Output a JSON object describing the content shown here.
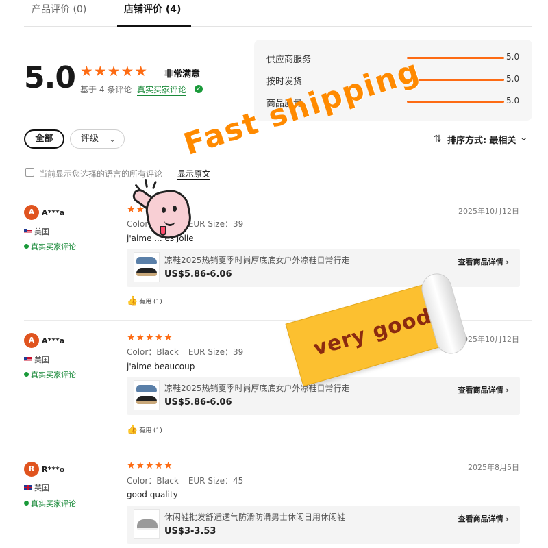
{
  "tabs": [
    {
      "label": "产品评价 (0)"
    },
    {
      "label": "店铺评价 (4)"
    }
  ],
  "summary": {
    "rating": "5.0",
    "stars": "★★★★★",
    "satisfaction": "非常满意",
    "based_on": "基于 4 条评论",
    "verified_link": "真实买家评论",
    "verified_icon": "check-shield-icon"
  },
  "subratings": [
    {
      "label": "供应商服务",
      "value": "5.0",
      "fill": 1.0
    },
    {
      "label": "按时发货",
      "value": "5.0",
      "fill": 1.0
    },
    {
      "label": "商品质量",
      "value": "5.0",
      "fill": 1.0
    }
  ],
  "filters": {
    "all": "全部",
    "grade": "评级",
    "sort_label": "排序方式:",
    "sort_value": "最相关"
  },
  "language_note": {
    "text": "当前显示您选择的语言的所有评论",
    "show_original": "显示原文"
  },
  "reviews": [
    {
      "avatar": "A",
      "user": "A***a",
      "country": "美国",
      "verified": "真实买家评论",
      "stars": "★★★★★",
      "date": "2025年10月12日",
      "color": "Color：Black",
      "size": "EUR Size：39",
      "text": "j'aime ... es jolie",
      "product_title": "凉鞋2025热销夏季时尚厚底底女户外凉鞋日常行走",
      "product_price": "US$5.86-6.06",
      "product_link": "查看商品详情 ›",
      "helpful": "有用 (1)"
    },
    {
      "avatar": "A",
      "user": "A***a",
      "country": "美国",
      "verified": "真实买家评论",
      "stars": "★★★★★",
      "date": "2025年10月12日",
      "color": "Color：Black",
      "size": "EUR Size：39",
      "text": "j'aime beaucoup",
      "product_title": "凉鞋2025热销夏季时尚厚底底女户外凉鞋日常行走",
      "product_price": "US$5.86-6.06",
      "product_link": "查看商品详情 ›",
      "helpful": "有用 (1)"
    },
    {
      "avatar": "R",
      "user": "R***o",
      "country": "英国",
      "verified": "真实买家评论",
      "stars": "★★★★★",
      "date": "2025年8月5日",
      "color": "Color：Black",
      "size": "EUR Size：45",
      "text": "good quality",
      "product_title": "休闲鞋批发舒适透气防滑防滑男士休闲日用休闲鞋",
      "product_price": "US$3-3.53",
      "product_link": "查看商品详情 ›"
    }
  ],
  "stickers": {
    "fast_shipping": "Fast shipping",
    "very_good": "very good"
  },
  "colors": {
    "accent": "#fd6b13",
    "verified": "#1a8a3a",
    "sticker_orange": "#ff8a00",
    "sticker_paper": "#fcc030"
  }
}
